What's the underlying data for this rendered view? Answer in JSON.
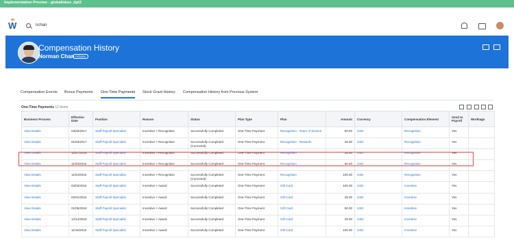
{
  "env_bar": {
    "label": "Implementation Preview - globalinkes_dpt2"
  },
  "search": {
    "value": "nchan"
  },
  "header": {
    "title": "Compensation History",
    "name": "Norman Chan",
    "badge": "Actions"
  },
  "tabs": [
    {
      "label": "Compensation Events",
      "active": false
    },
    {
      "label": "Bonus Payments",
      "active": false
    },
    {
      "label": "One-Time Payments",
      "active": true
    },
    {
      "label": "Stock Grant History",
      "active": false
    },
    {
      "label": "Compensation History from Previous System",
      "active": false
    }
  ],
  "grid": {
    "title": "One-Time Payments",
    "count": "12 items",
    "columns": [
      "Business Process",
      "Effective Date",
      "Position",
      "Reason",
      "Status",
      "Plan Type",
      "Plan",
      "Amount",
      "Currency",
      "Compensation Element",
      "Send to Payroll",
      "Worktags"
    ],
    "rows": [
      [
        "View Details",
        "03/20/2017",
        "Staff Payroll Specialist",
        "Incentive > Recognition",
        "Successfully Completed",
        "One-Time Payment",
        "Recognition - Years of Service",
        "50.00",
        "USD",
        "Recognition",
        "Yes",
        ""
      ],
      [
        "View Details",
        "01/03/2017",
        "Staff Payroll Specialist",
        "Incentive > Recognition",
        "Successfully Completed (Corrected)",
        "One-Time Payment",
        "Recognition - Rewards",
        "25.00",
        "USD",
        "Recognition",
        "Yes",
        ""
      ],
      [
        "View Details",
        "11/07/2016",
        "Staff Payroll Specialist",
        "Incentive > Recognition",
        "Successfully Completed",
        "One-Time Payment",
        "Recognition",
        "25.00",
        "USD",
        "Recognition",
        "Yes",
        ""
      ],
      [
        "View Details",
        "11/03/2016",
        "Staff Payroll Specialist",
        "Incentive > Recognition",
        "Successfully Completed",
        "One-Time Payment",
        "Recognition",
        "50.00",
        "USD",
        "Recognition",
        "Yes",
        ""
      ],
      [
        "View Details",
        "11/04/2016",
        "Staff Payroll Specialist",
        "Incentive > Recognition",
        "Successfully Completed (Corrected)",
        "One-Time Payment",
        "Recognition",
        "100.00",
        "USD",
        "Recognition",
        "Yes",
        ""
      ],
      [
        "View Details",
        "02/03/2016",
        "Staff Payroll Specialist",
        "Incentive > Award",
        "Successfully Completed",
        "One-Time Payment",
        "Gift Card",
        "100.00",
        "USD",
        "Incentive",
        "Yes",
        ""
      ],
      [
        "View Details",
        "02/01/2016",
        "Staff Payroll Specialist",
        "Incentive > Award",
        "Successfully Completed",
        "One-Time Payment",
        "Gift Card",
        "25.00",
        "USD",
        "Incentive",
        "Yes",
        ""
      ],
      [
        "View Details",
        "01/05/2016",
        "Staff Payroll Specialist",
        "Incentive > Award",
        "Successfully Completed",
        "One-Time Payment",
        "Gift Card",
        "50.00",
        "USD",
        "Incentive",
        "Yes",
        ""
      ],
      [
        "View Details",
        "12/14/2015",
        "Staff Payroll Specialist",
        "Incentive > Award",
        "Successfully Completed",
        "One-Time Payment",
        "Gift Card",
        "25.00",
        "USD",
        "Incentive",
        "Yes",
        ""
      ],
      [
        "View Details",
        "11/16/2015",
        "Staff Payroll Specialist",
        "Incentive > Award",
        "Successfully Completed",
        "One-Time Payment",
        "Gift Card",
        "100.00",
        "USD",
        "Incentive",
        "Yes",
        ""
      ]
    ]
  },
  "colors": {
    "env_bar": "#5ec08c",
    "hero": "#1e73d8",
    "link": "#1e73d8",
    "highlight": "#e4453a"
  },
  "icons": [
    "workday-logo",
    "search-icon",
    "bell-icon",
    "inbox-icon",
    "avatar",
    "grid-view-icon",
    "print-icon"
  ]
}
